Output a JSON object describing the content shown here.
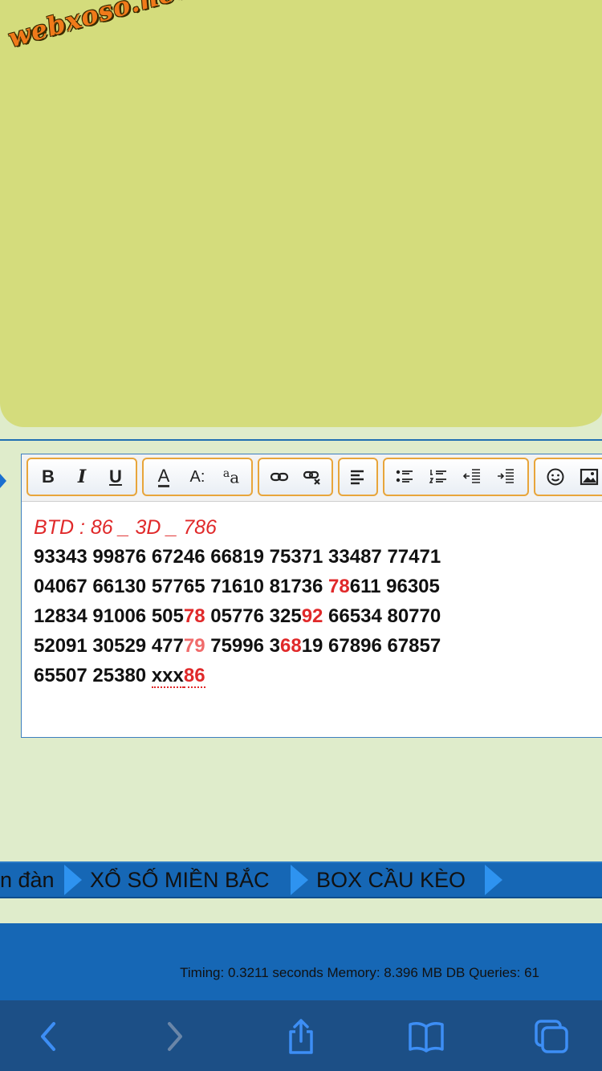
{
  "logo": {
    "text": "webxoso.net"
  },
  "editor": {
    "toolbar": {
      "bold": "B",
      "italic": "I",
      "underline": "U",
      "font_color": "A",
      "font_size": "A:",
      "font_face": "a"
    },
    "btd_line": "BTD : 86 _ 3D _ 786",
    "lines": [
      [
        {
          "t": "93343 99876 67246 66819 75371 33487 77471"
        }
      ],
      [
        {
          "t": "04067 66130 57765 71610 81736 "
        },
        {
          "t": "78",
          "c": "red"
        },
        {
          "t": "611 96305"
        }
      ],
      [
        {
          "t": "12834 91006 505"
        },
        {
          "t": "78",
          "c": "red"
        },
        {
          "t": " 05776 325"
        },
        {
          "t": "92",
          "c": "red"
        },
        {
          "t": " 66534 80770"
        }
      ],
      [
        {
          "t": "52091 30529 477"
        },
        {
          "t": "79",
          "c": "pink"
        },
        {
          "t": " 75996 3"
        },
        {
          "t": "68",
          "c": "red"
        },
        {
          "t": "19 67896 67857"
        }
      ],
      [
        {
          "t": "65507 25380 "
        },
        {
          "t": "xxx",
          "c": "xxx"
        },
        {
          "t": "86",
          "c": "red xxx"
        }
      ]
    ]
  },
  "nav": {
    "items": [
      "n đàn",
      "XỔ SỐ MIỀN BẮC",
      "BOX CẦU KÈO"
    ]
  },
  "footer": {
    "timing": "Timing: 0.3211 seconds Memory: 8.396 MB DB Queries: 61"
  },
  "colors": {
    "accent_red": "#e0292a",
    "nav_blue": "#1667b5",
    "logo_orange": "#f07a1a"
  },
  "icons": [
    "link-icon",
    "unlink-icon",
    "align-left-icon",
    "bullet-list-icon",
    "numbered-list-icon",
    "outdent-icon",
    "indent-icon",
    "smiley-icon",
    "image-icon",
    "back-icon",
    "forward-icon",
    "share-icon",
    "bookmarks-icon",
    "tabs-icon"
  ]
}
